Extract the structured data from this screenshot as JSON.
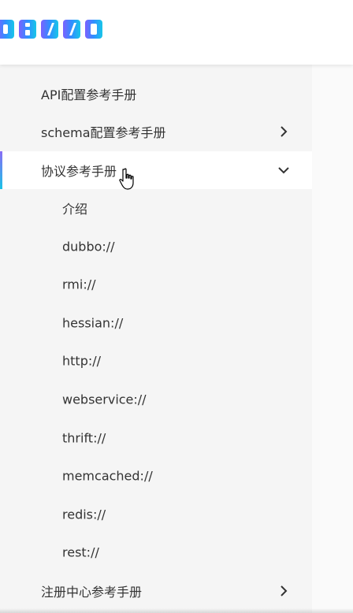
{
  "logo": {
    "text": "DUBBO",
    "colors": [
      "#7b61ff",
      "#5a7bff",
      "#2f8fff",
      "#1fb3f0",
      "#18c6e8"
    ]
  },
  "menu": {
    "api_config": "API配置参考手册",
    "schema_config": "schema配置参考手册",
    "protocol_ref": "协议参考手册",
    "protocol_items": [
      "介绍",
      "dubbo://",
      "rmi://",
      "hessian://",
      "http://",
      "webservice://",
      "thrift://",
      "memcached://",
      "redis://",
      "rest://"
    ],
    "registry_ref": "注册中心参考手册"
  },
  "icons": {
    "schema_chevron": "chevron-right-icon",
    "protocol_chevron": "chevron-down-icon",
    "registry_chevron": "chevron-right-icon",
    "cursor": "hand-pointer-icon"
  },
  "colors": {
    "active_bar_top": "#8a6cf6",
    "active_bar_bottom": "#19c3e6",
    "sidebar_bg": "#f5f5f5",
    "text": "#333333"
  }
}
